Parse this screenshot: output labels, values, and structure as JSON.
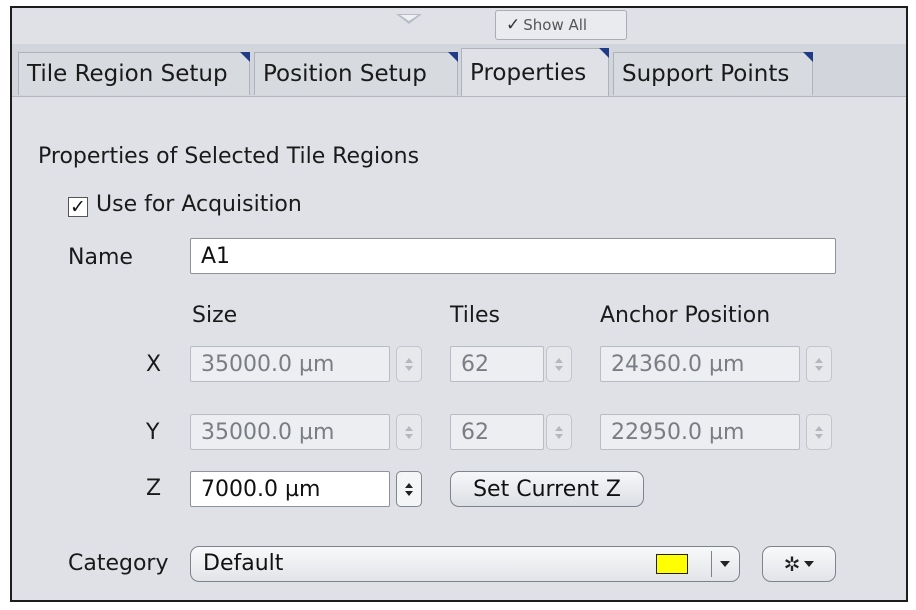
{
  "toolbar": {
    "show_all_check": "✓",
    "show_all_label": "Show All"
  },
  "tabs": [
    {
      "label": "Tile Region Setup",
      "active": false
    },
    {
      "label": "Position Setup",
      "active": false
    },
    {
      "label": "Properties",
      "active": true
    },
    {
      "label": "Support Points",
      "active": false
    }
  ],
  "section_title": "Properties of Selected Tile Regions",
  "use_for_acquisition": {
    "label": "Use for Acquisition",
    "checked": true,
    "check_glyph": "✓"
  },
  "name": {
    "label": "Name",
    "value": "A1"
  },
  "columns": {
    "size": "Size",
    "tiles": "Tiles",
    "anchor": "Anchor Position"
  },
  "rows": {
    "x": {
      "axis": "X",
      "size": "35000.0 µm",
      "tiles": "62",
      "anchor": "24360.0 µm"
    },
    "y": {
      "axis": "Y",
      "size": "35000.0 µm",
      "tiles": "62",
      "anchor": "22950.0 µm"
    },
    "z": {
      "axis": "Z",
      "size": "7000.0 µm",
      "button": "Set Current Z"
    }
  },
  "category": {
    "label": "Category",
    "value": "Default",
    "swatch_color": "#ffff00",
    "gear_glyph": "✲"
  }
}
